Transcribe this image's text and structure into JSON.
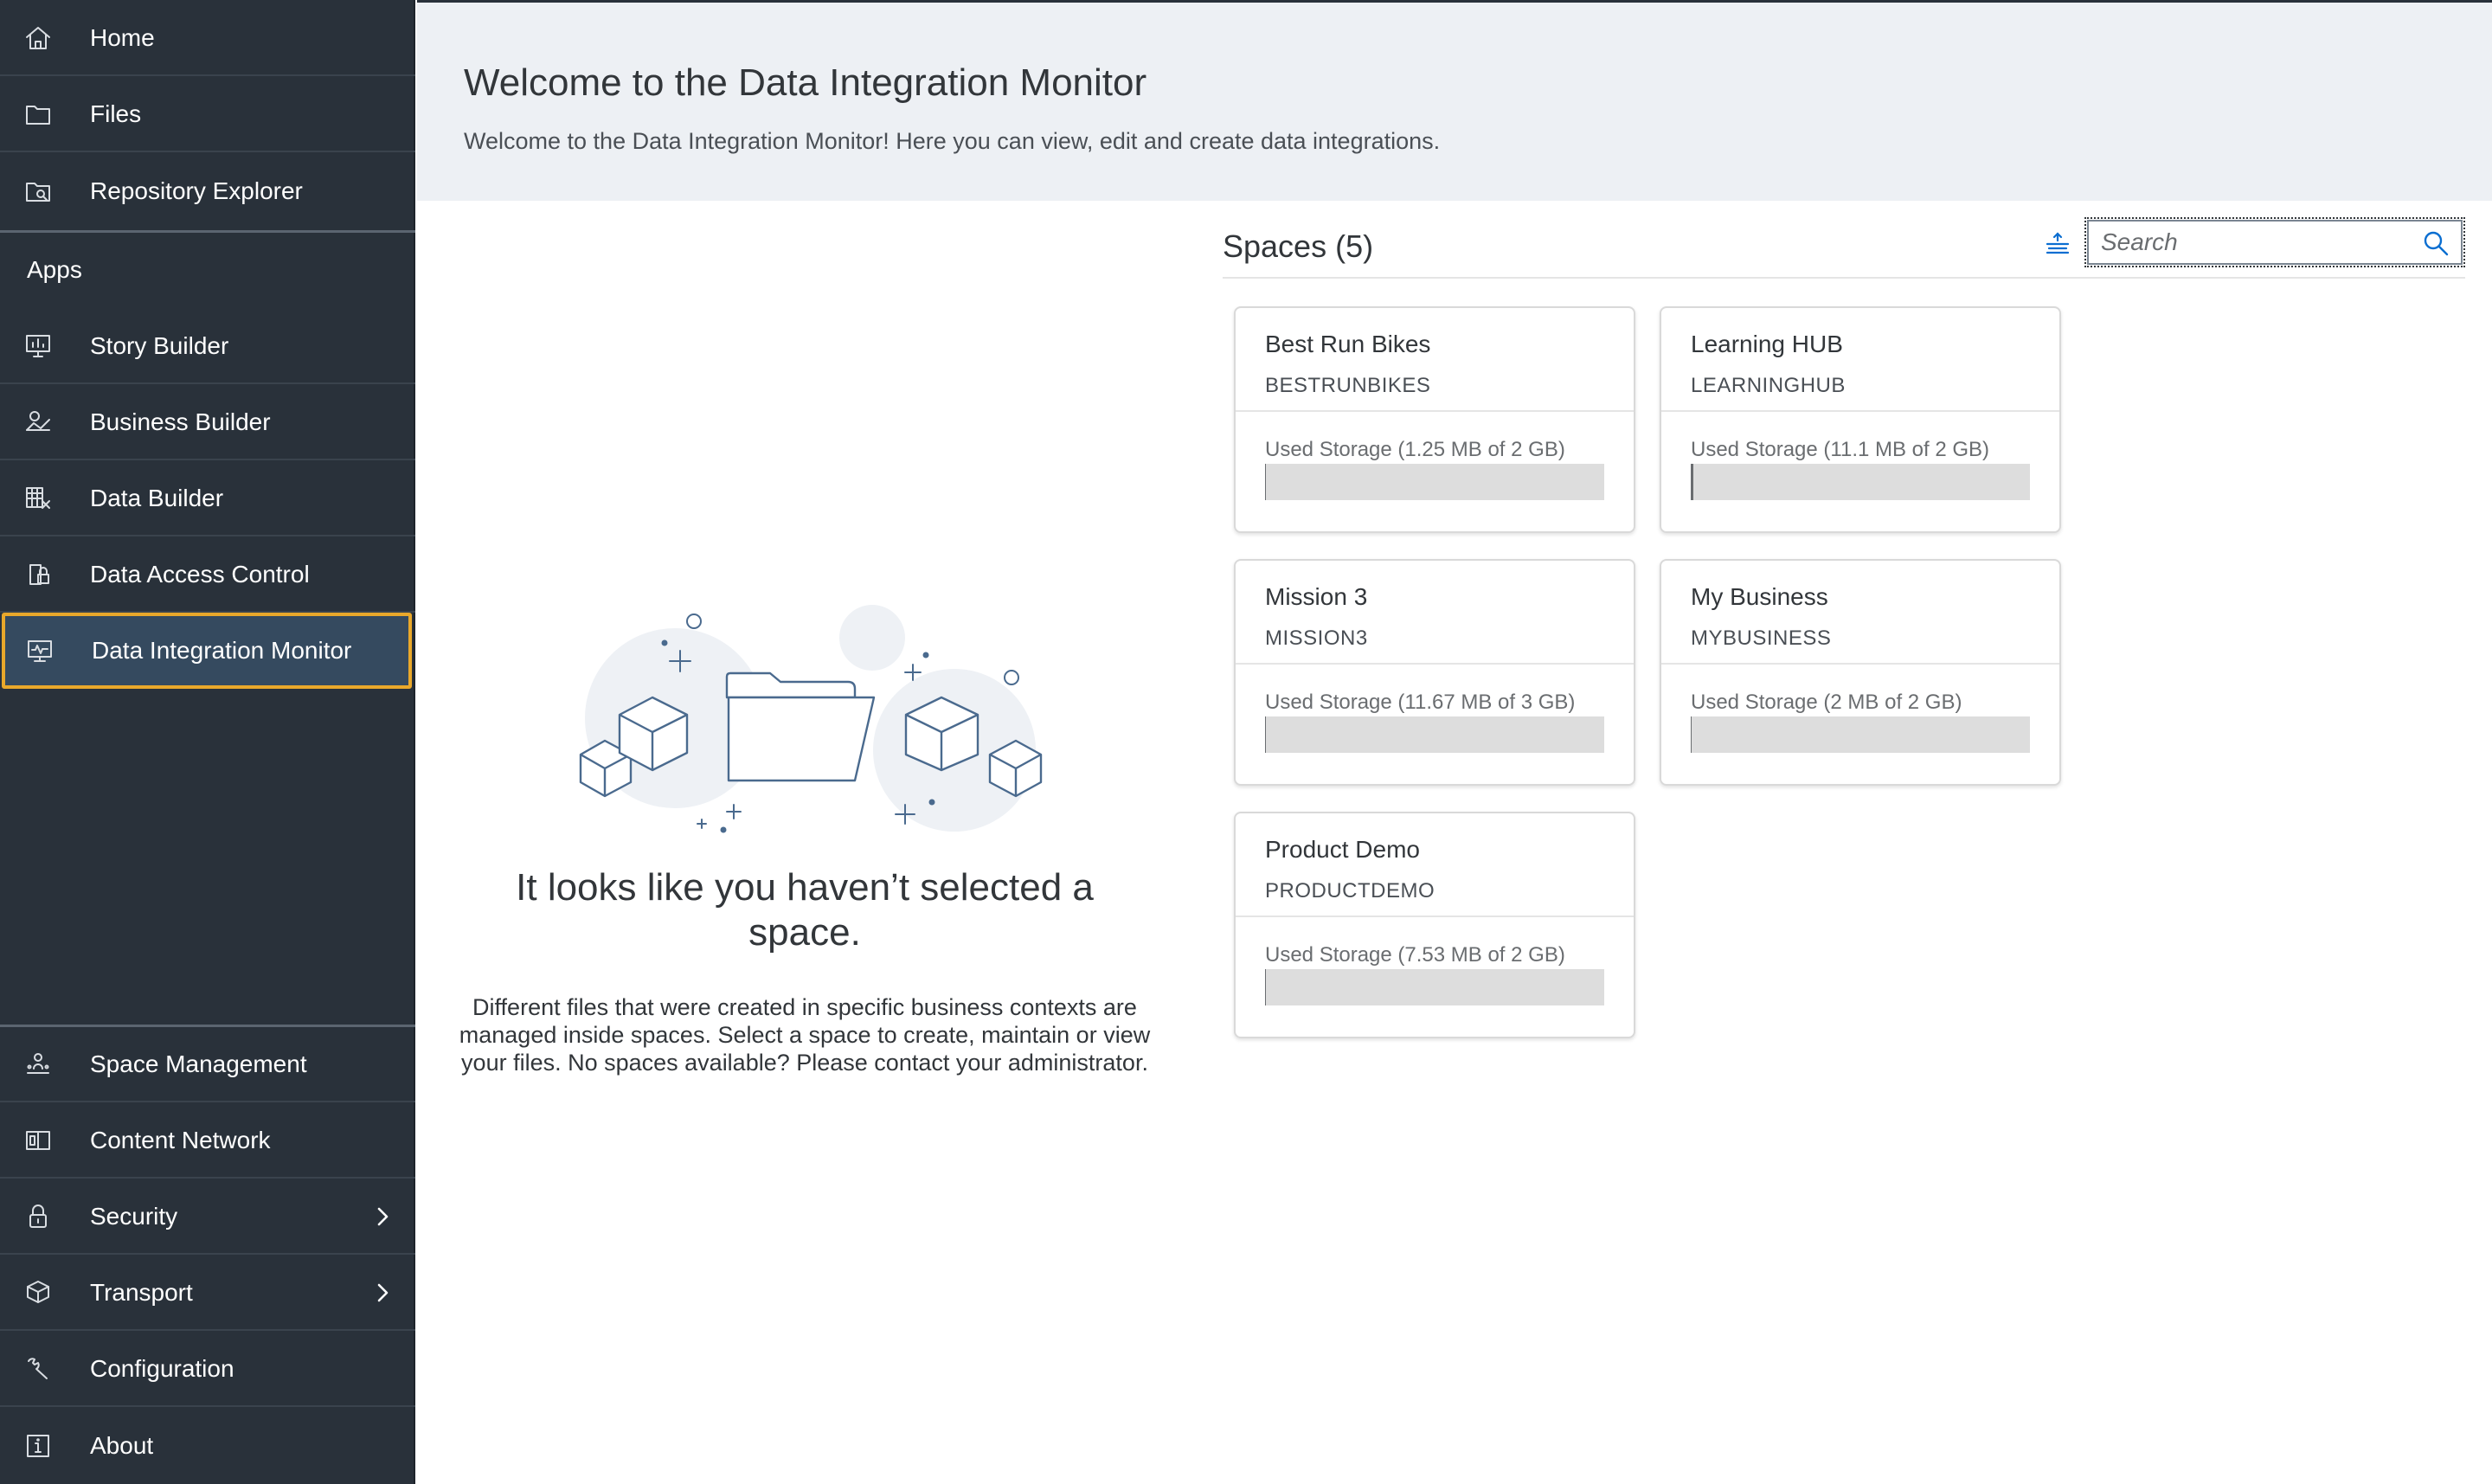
{
  "sidebar": {
    "top_items": [
      {
        "label": "Home",
        "icon": "home-icon"
      },
      {
        "label": "Files",
        "icon": "folder-icon"
      },
      {
        "label": "Repository Explorer",
        "icon": "repository-icon"
      }
    ],
    "apps_header": "Apps",
    "app_items": [
      {
        "label": "Story Builder",
        "icon": "story-icon"
      },
      {
        "label": "Business Builder",
        "icon": "business-icon"
      },
      {
        "label": "Data Builder",
        "icon": "data-builder-icon"
      },
      {
        "label": "Data Access Control",
        "icon": "access-control-icon"
      },
      {
        "label": "Data Integration Monitor",
        "icon": "monitor-icon",
        "active": true
      }
    ],
    "bottom_items": [
      {
        "label": "Space Management",
        "icon": "space-management-icon"
      },
      {
        "label": "Content Network",
        "icon": "content-network-icon"
      },
      {
        "label": "Security",
        "icon": "lock-icon",
        "has_submenu": true
      },
      {
        "label": "Transport",
        "icon": "transport-icon",
        "has_submenu": true
      },
      {
        "label": "Configuration",
        "icon": "wrench-icon"
      },
      {
        "label": "About",
        "icon": "info-icon"
      }
    ]
  },
  "header": {
    "title": "Welcome to the Data Integration Monitor",
    "subtitle": "Welcome to the Data Integration Monitor! Here you can view, edit and create data integrations."
  },
  "empty_state": {
    "title": "It looks like you haven’t selected a space.",
    "description": "Different files that were created in specific business contexts are managed inside spaces. Select a space to create, maintain or view your files. No spaces available? Please contact your administrator."
  },
  "spaces": {
    "title": "Spaces (5)",
    "search_placeholder": "Search",
    "items": [
      {
        "name": "Best Run Bikes",
        "id": "BESTRUNBIKES",
        "storage": "Used Storage (1.25 MB of 2 GB)",
        "used_fraction": 0.0006
      },
      {
        "name": "Learning HUB",
        "id": "LEARNINGHUB",
        "storage": "Used Storage (11.1 MB of 2 GB)",
        "used_fraction": 0.0054
      },
      {
        "name": "Mission 3",
        "id": "MISSION3",
        "storage": "Used Storage (11.67 MB of 3 GB)",
        "used_fraction": 0.0038
      },
      {
        "name": "My Business",
        "id": "MYBUSINESS",
        "storage": "Used Storage (2 MB of 2 GB)",
        "used_fraction": 0.001
      },
      {
        "name": "Product Demo",
        "id": "PRODUCTDEMO",
        "storage": "Used Storage (7.53 MB of 2 GB)",
        "used_fraction": 0.0037
      }
    ]
  },
  "colors": {
    "sidebar_bg": "#29313a",
    "active_bg": "#354a5f",
    "active_border": "#e9a82b",
    "header_bg": "#edf0f4",
    "accent": "#0a6ed1"
  }
}
